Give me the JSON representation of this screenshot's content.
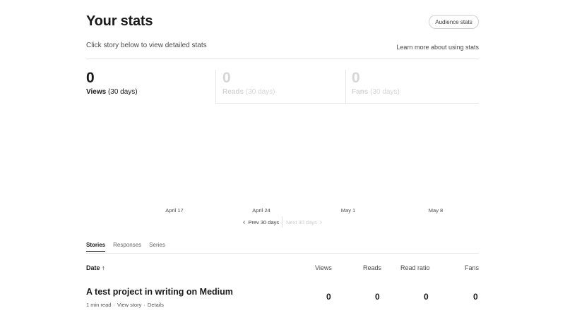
{
  "header": {
    "title": "Your stats",
    "audience_button": "Audience stats",
    "subtitle": "Click story below to view detailed stats",
    "learn_link": "Learn more about using stats"
  },
  "stats": {
    "views": {
      "value": "0",
      "label": "Views",
      "period": "(30 days)"
    },
    "reads": {
      "value": "0",
      "label": "Reads",
      "period": "(30 days)"
    },
    "fans": {
      "value": "0",
      "label": "Fans",
      "period": "(30 days)"
    }
  },
  "chart": {
    "date_labels": [
      "April 17",
      "April 24",
      "May 1",
      "May 8"
    ]
  },
  "pager": {
    "prev_label": "Prev 30 days",
    "next_label": "Next 30 days"
  },
  "tabs": [
    "Stories",
    "Responses",
    "Series"
  ],
  "table": {
    "headers": {
      "date": "Date",
      "sort_arrow": "↑",
      "views": "Views",
      "reads": "Reads",
      "read_ratio": "Read ratio",
      "fans": "Fans"
    },
    "rows": [
      {
        "title": "A test project in writing on Medium",
        "read_time": "1 min read",
        "view_story": "View story",
        "details": "Details",
        "views": "0",
        "reads": "0",
        "read_ratio": "0",
        "fans": "0"
      }
    ]
  }
}
